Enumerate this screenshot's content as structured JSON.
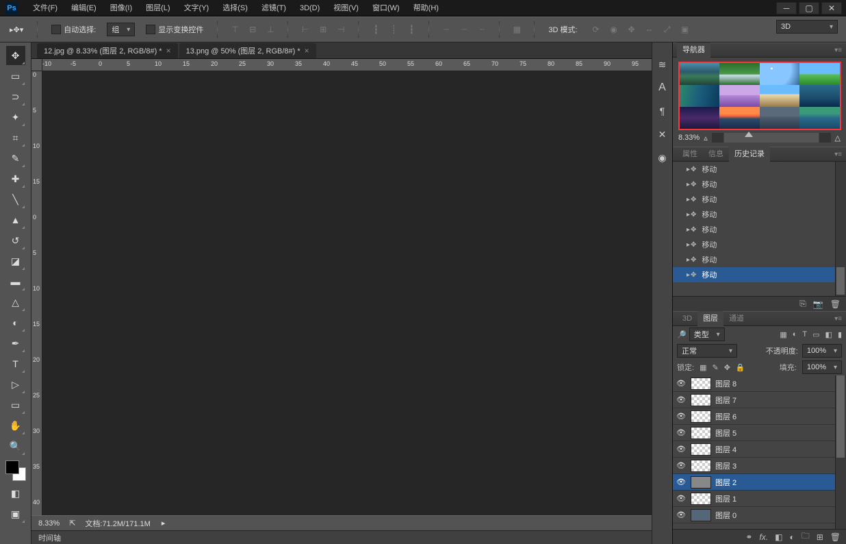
{
  "menu": [
    "文件(F)",
    "编辑(E)",
    "图像(I)",
    "图层(L)",
    "文字(Y)",
    "选择(S)",
    "滤镜(T)",
    "3D(D)",
    "视图(V)",
    "窗口(W)",
    "帮助(H)"
  ],
  "options": {
    "autoSelectLabel": "自动选择:",
    "groupLabel": "组",
    "showTransformLabel": "显示变换控件",
    "mode3d": "3D 模式:",
    "rightSelect": "3D"
  },
  "tabs": [
    {
      "label": "12.jpg @ 8.33% (图层 2, RGB/8#) *",
      "active": true
    },
    {
      "label": "13.png @ 50% (图层 2, RGB/8#) *",
      "active": false
    }
  ],
  "rulerH": [
    -10,
    -5,
    0,
    5,
    10,
    15,
    20,
    25,
    30,
    35,
    40,
    45,
    50,
    55,
    60,
    65,
    70,
    75,
    80,
    85,
    90,
    95
  ],
  "rulerV": [
    0,
    5,
    10,
    15,
    0,
    5,
    10,
    15,
    20,
    25,
    30,
    35,
    40
  ],
  "status": {
    "zoom": "8.33%",
    "docLabel": "文档:",
    "docSize": "71.2M/171.1M"
  },
  "timeline": "时间轴",
  "panels": {
    "navigator": {
      "title": "导航器",
      "zoom": "8.33%"
    },
    "historyTabs": [
      "属性",
      "信息",
      "历史记录"
    ],
    "historyItems": [
      "移动",
      "移动",
      "移动",
      "移动",
      "移动",
      "移动",
      "移动",
      "移动"
    ],
    "layersTabs": [
      "3D",
      "图层",
      "通道"
    ],
    "kind": "类型",
    "blend": "正常",
    "opacityLabel": "不透明度:",
    "opacity": "100%",
    "lockLabel": "锁定:",
    "fillLabel": "填充:",
    "fill": "100%",
    "layers": [
      {
        "name": "图层 8",
        "sel": false,
        "trans": true
      },
      {
        "name": "图层 7",
        "sel": false,
        "trans": true
      },
      {
        "name": "图层 6",
        "sel": false,
        "trans": true
      },
      {
        "name": "图层 5",
        "sel": false,
        "trans": true
      },
      {
        "name": "图层 4",
        "sel": false,
        "trans": true
      },
      {
        "name": "图层 3",
        "sel": false,
        "trans": true
      },
      {
        "name": "图层 2",
        "sel": true,
        "trans": false
      },
      {
        "name": "图层 1",
        "sel": false,
        "trans": true
      },
      {
        "name": "图层 0",
        "sel": false,
        "trans": false,
        "filled": true
      }
    ]
  },
  "thumbs": [
    "linear-gradient(#4a8ea8,#2b5a6c 40%,#3a7a5a 60%,#224433)",
    "linear-gradient(#2a6e2a,#4a9a4a 50%,#cde 55%,#2a6e2a)",
    "radial-gradient(circle at 30% 25%,#fff 0 2%,#88c6ff 4% 60%,#336699)",
    "linear-gradient(#6bbcff 50%,#5abf5a 52%,#2a8a2a)",
    "linear-gradient(100deg,#2a8a6a,#1b5c7c 50%,#0a3a5c)",
    "linear-gradient(#cda8e8 45%,#b488d8 48%,#7a4aa8)",
    "linear-gradient(#6bbcff 40%,#e8d8a8 45%,#9a7a4a)",
    "linear-gradient(#2a6a8a,#1b4c6c 60%,#0a2a4c)",
    "linear-gradient(#1a1a4a,#4a2a6a 50%,#1a1a3a)",
    "linear-gradient(#ff8a4a 30%,#ff6a3a 40%,#2a4a6a 55%,#1a2a4a)",
    "linear-gradient(#5a6a7a 40%,#4a5a6a 50%,#2a3a4a)",
    "linear-gradient(#3a9a7a 30%,#2a6a8a 50%,#1a4a6a)"
  ]
}
